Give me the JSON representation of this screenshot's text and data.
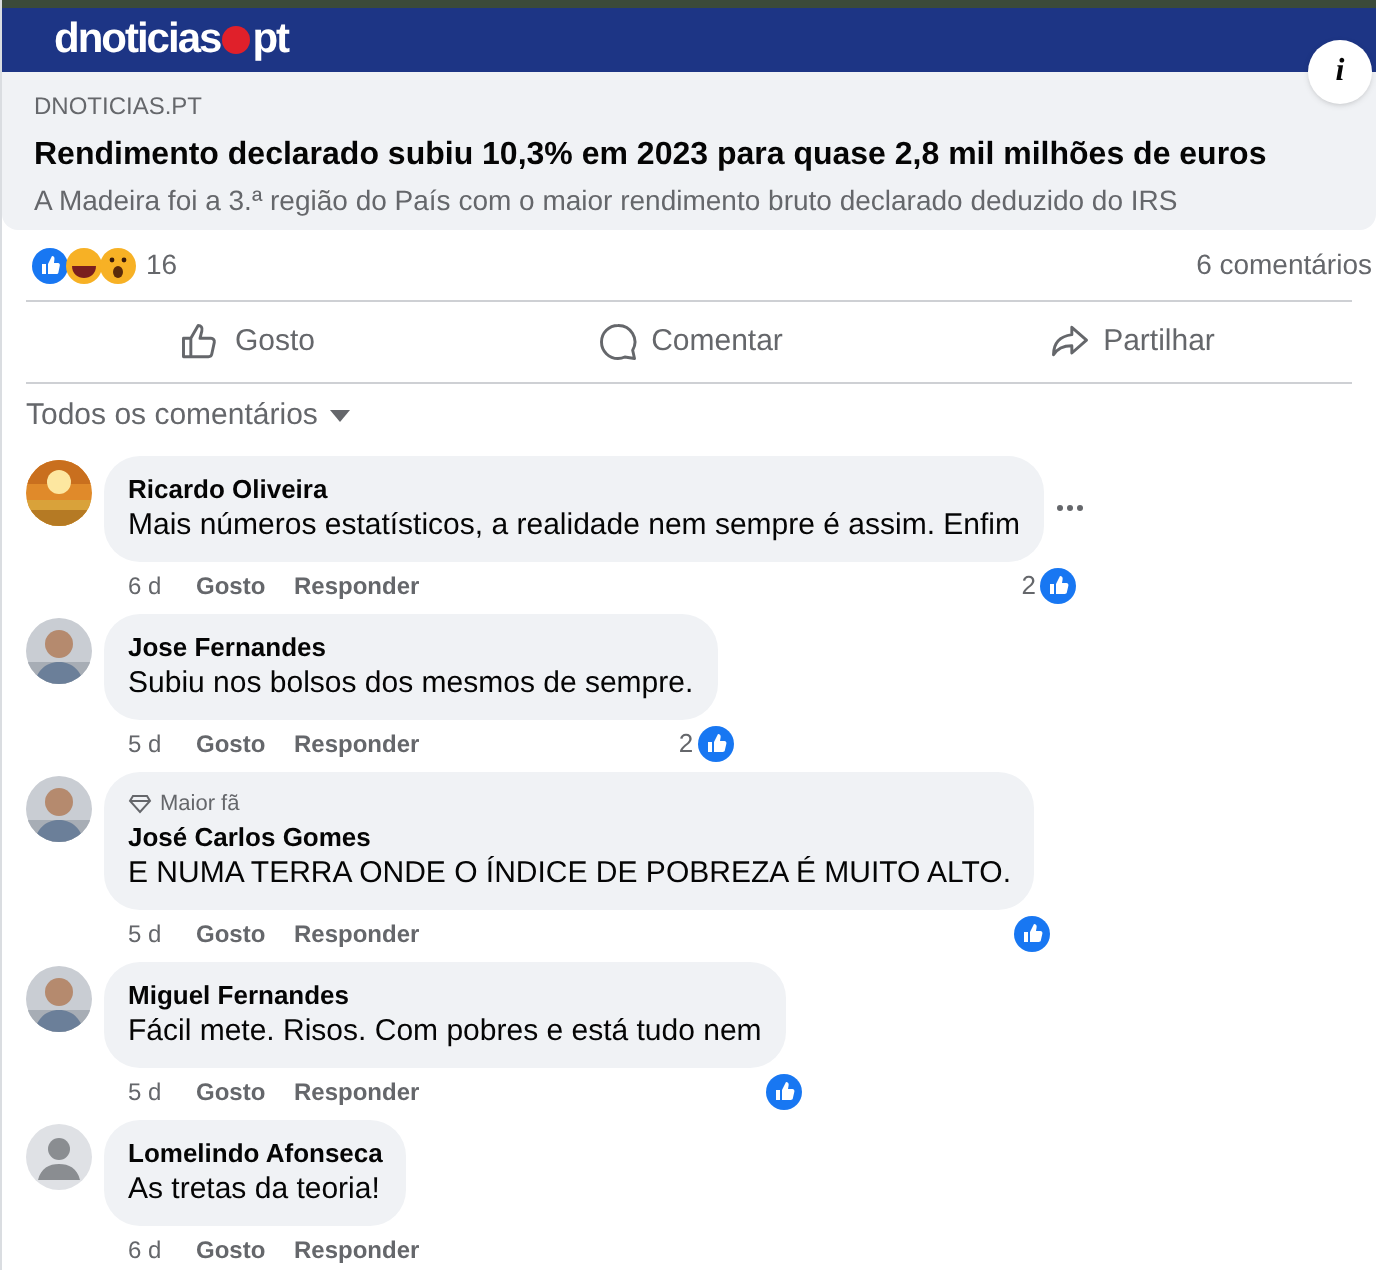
{
  "banner": {
    "logo_left": "dnoticias",
    "logo_right": "pt",
    "info": "i"
  },
  "link": {
    "source": "DNOTICIAS.PT",
    "title": "Rendimento declarado subiu 10,3% em 2023 para quase 2,8 mil milhões de euros",
    "description": "A Madeira foi a 3.ª região do País com o maior rendimento bruto declarado deduzido do IRS"
  },
  "stats": {
    "reactions": "16",
    "comments": "6 comentários"
  },
  "actions": [
    {
      "kind": "like",
      "label": "Gosto"
    },
    {
      "kind": "comment",
      "label": "Comentar"
    },
    {
      "kind": "share",
      "label": "Partilhar"
    }
  ],
  "filter": {
    "label": "Todos os comentários"
  },
  "comments": [
    {
      "kind": "picture",
      "name": "Ricardo Oliveira",
      "text": "Mais números estatísticos, a realidade nem sempre é assim. Enfim",
      "time": "6 d",
      "like": "Gosto",
      "reply": "Responder",
      "liked": true,
      "like_count": "2",
      "menu_visible": true
    },
    {
      "kind": "picture",
      "name": "Jose Fernandes",
      "text": "Subiu nos bolsos dos mesmos de sempre.",
      "time": "5 d",
      "like": "Gosto",
      "reply": "Responder",
      "liked": true,
      "like_count": "2",
      "menu_visible": false
    },
    {
      "kind": "picture",
      "badge": "Maior fã",
      "name": "José Carlos Gomes",
      "text": "E NUMA TERRA ONDE O ÍNDICE DE POBREZA É MUITO ALTO.",
      "time": "5 d",
      "like": "Gosto",
      "reply": "Responder",
      "liked": true,
      "menu_visible": false
    },
    {
      "kind": "picture",
      "name": "Miguel Fernandes",
      "text": "Fácil mete. Risos. Com pobres e está tudo nem",
      "time": "5 d",
      "like": "Gosto",
      "reply": "Responder",
      "liked": true,
      "menu_visible": false
    },
    {
      "kind": "default",
      "name": "Lomelindo Afonseca",
      "text": "As tretas da teoria!",
      "time": "6 d",
      "like": "Gosto",
      "reply": "Responder",
      "liked": false,
      "menu_visible": false
    }
  ]
}
